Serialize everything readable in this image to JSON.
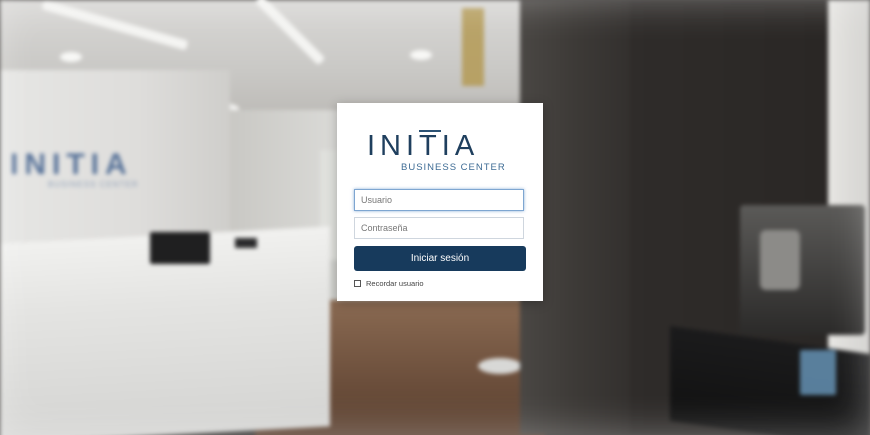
{
  "background": {
    "wall_logo_text": "INITIA",
    "wall_logo_sub": "BUSINESS CENTER"
  },
  "login": {
    "logo_main": "INITIA",
    "logo_sub": "BUSINESS CENTER",
    "username_placeholder": "Usuario",
    "password_placeholder": "Contraseña",
    "submit_label": "Iniciar sesión",
    "remember_label": "Recordar usuario",
    "remember_checked": false
  },
  "colors": {
    "brand": "#1f3f5e",
    "button": "#173a5c",
    "focus": "#7ea6d1"
  }
}
